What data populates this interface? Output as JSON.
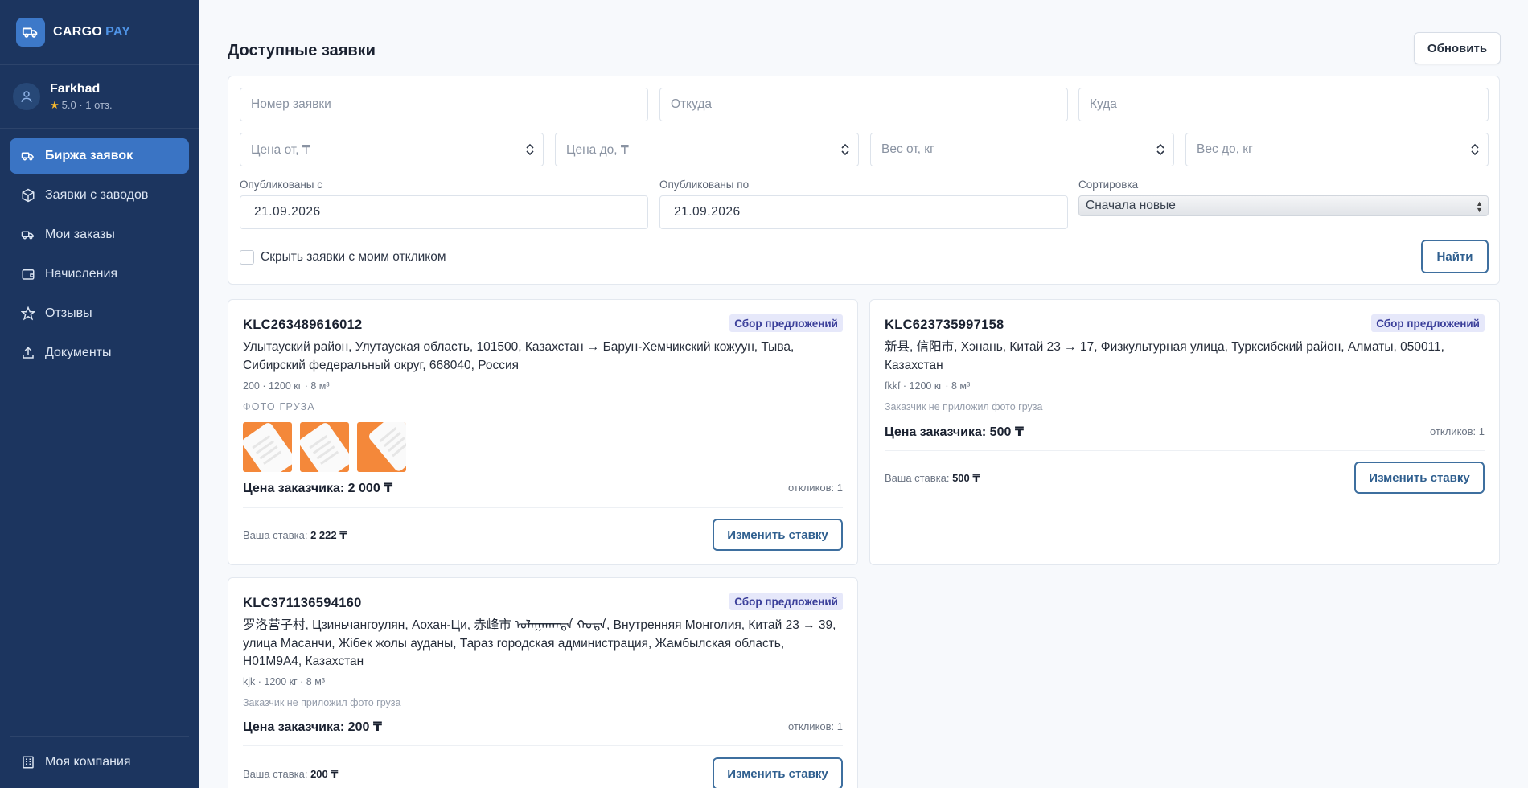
{
  "brand": {
    "name": "CARGO",
    "accent": "PAY"
  },
  "user": {
    "name": "Farkhad",
    "rating": "5.0 · 1 отз."
  },
  "sidebar": {
    "items": [
      {
        "label": "Биржа заявок",
        "icon": "truck-icon",
        "active": true
      },
      {
        "label": "Заявки с заводов",
        "icon": "box-icon",
        "active": false
      },
      {
        "label": "Мои заказы",
        "icon": "truck-icon",
        "active": false
      },
      {
        "label": "Начисления",
        "icon": "wallet-icon",
        "active": false
      },
      {
        "label": "Отзывы",
        "icon": "star-icon",
        "active": false
      },
      {
        "label": "Документы",
        "icon": "upload-icon",
        "active": false
      }
    ],
    "bottom": {
      "label": "Моя компания",
      "icon": "building-icon"
    }
  },
  "header": {
    "title": "Доступные заявки",
    "refresh_label": "Обновить"
  },
  "filters": {
    "order_number_placeholder": "Номер заявки",
    "from_placeholder": "Откуда",
    "to_placeholder": "Куда",
    "price_from_placeholder": "Цена от, ₸",
    "price_to_placeholder": "Цена до, ₸",
    "weight_from_placeholder": "Вес от, кг",
    "weight_to_placeholder": "Вес до, кг",
    "published_from_label": "Опубликованы с",
    "published_from_value": "21.09.2026",
    "published_to_label": "Опубликованы по",
    "published_to_value": "21.09.2026",
    "sort_label": "Сортировка",
    "sort_value": "Сначала новые",
    "hide_mine_label": "Скрыть заявки с моим откликом",
    "find_label": "Найти"
  },
  "orders": [
    {
      "id": "KLC263489616012",
      "status": "Сбор предложений",
      "route": "Улытауский район, Улутауская область, 101500, Казахстан → Барун-Хемчикский кожуун, Тыва, Сибирский федеральный округ, 668040, Россия",
      "meta": "200 · 1200 кг · 8 м³",
      "photo_label": "ФОТО ГРУЗА",
      "photos": [
        "cargo-photo-1",
        "cargo-photo-2",
        "cargo-photo-3"
      ],
      "price": "Цена заказчика: 2 000 ₸",
      "responses": "откликов: 1",
      "bid_label": "Ваша ставка:",
      "bid_value": "2 222 ₸",
      "button": "Изменить ставку"
    },
    {
      "id": "KLC623735997158",
      "status": "Сбор предложений",
      "route": "新县, 信阳市, Хэнань, Китай 23 → 17, Физкультурная улица, Турксибский район, Алматы, 050011, Казахстан",
      "meta": "fkkf · 1200 кг · 8 м³",
      "note": "Заказчик не приложил фото груза",
      "price": "Цена заказчика: 500 ₸",
      "responses": "откликов: 1",
      "bid_label": "Ваша ставка:",
      "bid_value": "500 ₸",
      "button": "Изменить ставку"
    },
    {
      "id": "KLC371136594160",
      "status": "Сбор предложений",
      "route": "罗洛营子村, Цзиньчангоулян, Аохан-Ци, 赤峰市 ᠤᠯᠠᠭᠠᠨᠬᠠᠳᠠ ᠬᠣᠲᠠ, Внутренняя Монголия, Китай 23 → 39, улица Масанчи, Жібек жолы ауданы, Тараз городская администрация, Жамбылская область, H01M9A4, Казахстан",
      "meta": "kjk · 1200 кг · 8 м³",
      "note": "Заказчик не приложил фото груза",
      "price": "Цена заказчика: 200 ₸",
      "responses": "откликов: 1",
      "bid_label": "Ваша ставка:",
      "bid_value": "200 ₸",
      "button": "Изменить ставку"
    }
  ],
  "colors": {
    "sidebar": "#1c355f",
    "accent": "#3a74c4",
    "badge_bg": "#e6e8fa",
    "badge_text": "#3b3f9a",
    "cargo_photo": "#f4883a"
  }
}
